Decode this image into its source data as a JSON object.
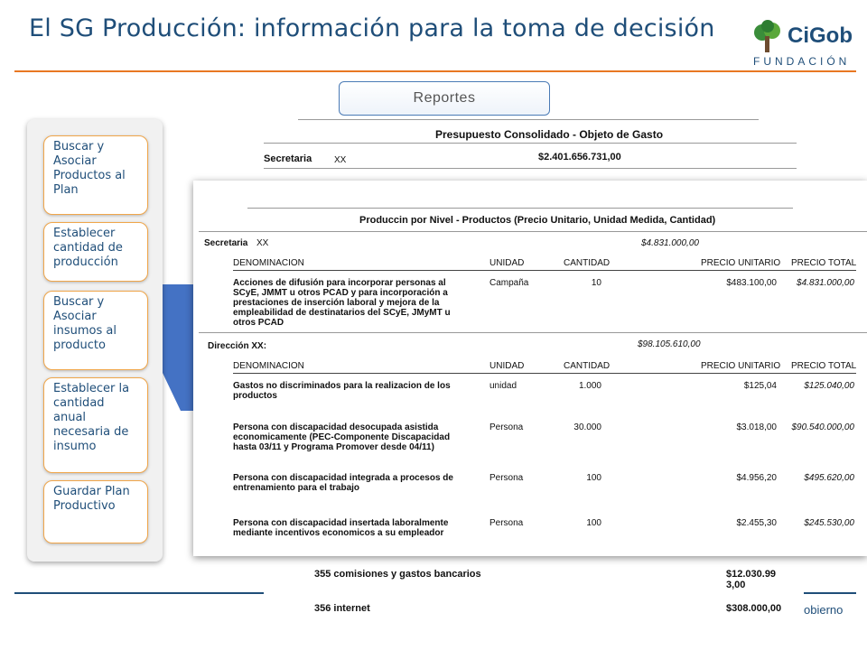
{
  "slide": {
    "title": "El SG Producción: información para la toma de decisión"
  },
  "logo": {
    "name": "CiGob",
    "sub": "FUNDACIÓN"
  },
  "tab": {
    "label": "Reportes"
  },
  "steps": [
    "Buscar y Asociar Productos al Plan",
    "Establecer cantidad de producción",
    "Buscar y Asociar insumos al producto",
    "Establecer la cantidad anual necesaria de insumo",
    "Guardar Plan Productivo"
  ],
  "back_report": {
    "title": "Presupuesto Consolidado - Objeto de Gasto",
    "secretaria_label": "Secretaria",
    "secretaria_name": "XX",
    "secretaria_amount": "$2.401.656.731,00",
    "rows": [
      {
        "label": "355 comisiones y gastos bancarios",
        "amount": "$12.030.993,00"
      },
      {
        "label": "356 internet",
        "amount": "$308.000,00"
      }
    ]
  },
  "front_report": {
    "title": "Produccin por Nivel - Productos (Precio Unitario, Unidad Medida, Cantidad)",
    "secretaria_label": "Secretaria",
    "secretaria_name": "XX",
    "secretaria_amount": "$4.831.000,00",
    "headers": [
      "DENOMINACION",
      "UNIDAD",
      "CANTIDAD",
      "PRECIO UNITARIO",
      "PRECIO TOTAL"
    ],
    "section1_rows": [
      {
        "name": "Acciones de difusión para incorporar personas al SCyE, JMMT u otros PCAD y para incorporación a prestaciones de inserción laboral y mejora de la empleabilidad de destinatarios del SCyE, JMyMT u otros PCAD",
        "unit": "Campaña",
        "qty": "10",
        "price": "$483.100,00",
        "total": "$4.831.000,00"
      }
    ],
    "direccion_label": "Dirección XX:",
    "direccion_amount": "$98.105.610,00",
    "section2_rows": [
      {
        "name": "Gastos no discriminados para la realizacion de los productos",
        "unit": "unidad",
        "qty": "1.000",
        "price": "$125,04",
        "total": "$125.040,00"
      },
      {
        "name": "Persona con discapacidad desocupada asistida economicamente (PEC-Componente Discapacidad hasta 03/11 y Programa Promover desde 04/11)",
        "unit": "Persona",
        "qty": "30.000",
        "price": "$3.018,00",
        "total": "$90.540.000,00"
      },
      {
        "name": "Persona con discapacidad integrada a procesos de entrenamiento para el trabajo",
        "unit": "Persona",
        "qty": "100",
        "price": "$4.956,20",
        "total": "$495.620,00"
      },
      {
        "name": "Persona con discapacidad insertada laboralmente mediante incentivos economicos a su empleador",
        "unit": "Persona",
        "qty": "100",
        "price": "$2.455,30",
        "total": "$245.530,00"
      }
    ]
  },
  "footer": {
    "text": "obierno"
  },
  "colors": {
    "title": "#1f4e79",
    "accent": "#e87722",
    "arrow": "#4472c4"
  }
}
